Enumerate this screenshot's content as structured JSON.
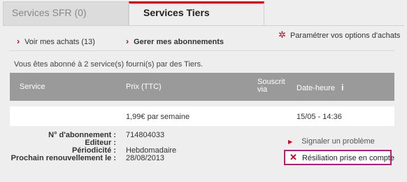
{
  "tabs": [
    {
      "label": "Services SFR (0)"
    },
    {
      "label": "Services Tiers"
    }
  ],
  "links": {
    "achats": "Voir mes achats (13)",
    "abonnements": "Gerer mes abonnements",
    "options": "Paramétrer vos options d'achats"
  },
  "subscription_info": "Vous êtes abonné à 2 service(s) fourni(s) par des Tiers.",
  "table": {
    "headers": {
      "service": "Service",
      "prix": "Prix (TTC)",
      "souscrit_line1": "Souscrit",
      "souscrit_line2": "via",
      "date": "Date-heure",
      "info_icon": "i"
    },
    "row": {
      "service": "",
      "prix": "1,99€  par semaine",
      "date": "15/05 - 14:36"
    },
    "details": {
      "labels": [
        "N° d'abonnement :",
        "Editeur :",
        "Périodicité :",
        "Prochain renouvellement le :"
      ],
      "values": [
        "714804033",
        "",
        "Hebdomadaire",
        "28/08/2013"
      ]
    }
  },
  "actions": {
    "signaler": "Signaler un problème",
    "resiliation": "Résiliation prise en compte"
  },
  "icons": {
    "arrow": "chevron-right-icon",
    "options": "gear-icon",
    "resiliation": "cross-icon",
    "info": "info-icon"
  },
  "colors": {
    "accent": "#c8001e",
    "header_bg": "#9a9a9a",
    "highlight_border": "#c0177a"
  }
}
